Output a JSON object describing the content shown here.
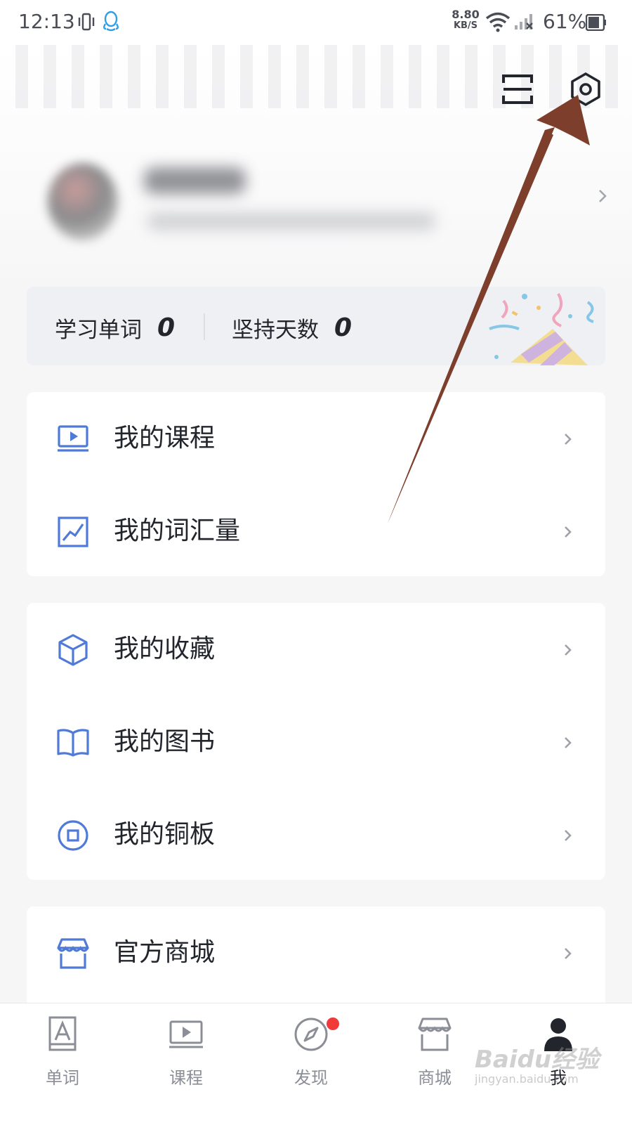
{
  "status_bar": {
    "time": "12:13",
    "net_speed_value": "8.80",
    "net_speed_unit": "KB/S",
    "battery_percent": "61%"
  },
  "header": {
    "scan_icon": "scan-icon",
    "settings_icon": "settings-hexagon-icon"
  },
  "stats": {
    "learned_words_label": "学习单词",
    "learned_words_value": "0",
    "streak_days_label": "坚持天数",
    "streak_days_value": "0"
  },
  "menu": {
    "my_courses": "我的课程",
    "my_vocabulary": "我的词汇量",
    "my_favorites": "我的收藏",
    "my_books": "我的图书",
    "my_coins": "我的铜板",
    "official_store": "官方商城"
  },
  "tabbar": {
    "words": "单词",
    "courses": "课程",
    "discover": "发现",
    "mall": "商城",
    "me": "我"
  },
  "watermark": {
    "brand": "Baidu经验",
    "url": "jingyan.baidu.com"
  },
  "colors": {
    "accent": "#4f7ad8",
    "annotation_arrow": "#7d3f2c",
    "badge_red": "#f2393a"
  }
}
